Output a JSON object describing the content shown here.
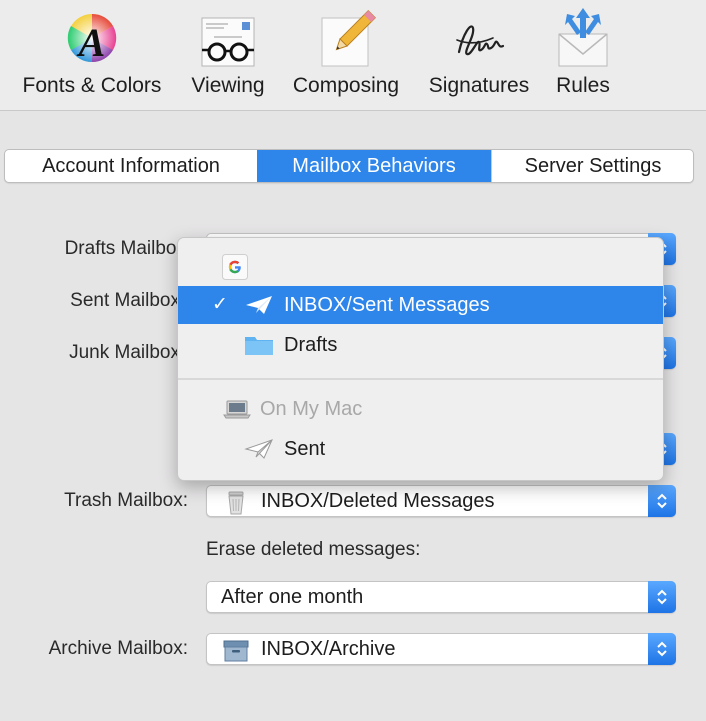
{
  "toolbar": {
    "items": [
      {
        "label": "Fonts & Colors",
        "icon": "fonts-colors-icon"
      },
      {
        "label": "Viewing",
        "icon": "viewing-glasses-icon"
      },
      {
        "label": "Composing",
        "icon": "composing-pencil-icon"
      },
      {
        "label": "Signatures",
        "icon": "signature-icon"
      },
      {
        "label": "Rules",
        "icon": "rules-envelope-icon"
      }
    ]
  },
  "tabs": [
    {
      "label": "Account Information",
      "active": false
    },
    {
      "label": "Mailbox Behaviors",
      "active": true
    },
    {
      "label": "Server Settings",
      "active": false
    }
  ],
  "form": {
    "drafts_label": "Drafts Mailbox",
    "sent_label": "Sent Mailbox",
    "junk_label": "Junk Mailbox",
    "trash_label": "Trash Mailbox:",
    "trash_value": "INBOX/Deleted Messages",
    "erase_label": "Erase deleted messages:",
    "erase_value": "After one month",
    "archive_label": "Archive Mailbox:",
    "archive_value": "INBOX/Archive"
  },
  "menu": {
    "account_icon": "google-icon",
    "items": [
      {
        "label": "INBOX/Sent Messages",
        "selected": true,
        "check": "✓",
        "icon": "sent-paper-plane-icon"
      },
      {
        "label": "Drafts",
        "selected": false,
        "icon": "folder-icon"
      }
    ],
    "section_label": "On My Mac",
    "section_icon": "laptop-icon",
    "section_items": [
      {
        "label": "Sent",
        "icon": "sent-paper-plane-icon"
      }
    ]
  },
  "colors": {
    "accent": "#2f86ea",
    "background": "#e6e5e6"
  }
}
